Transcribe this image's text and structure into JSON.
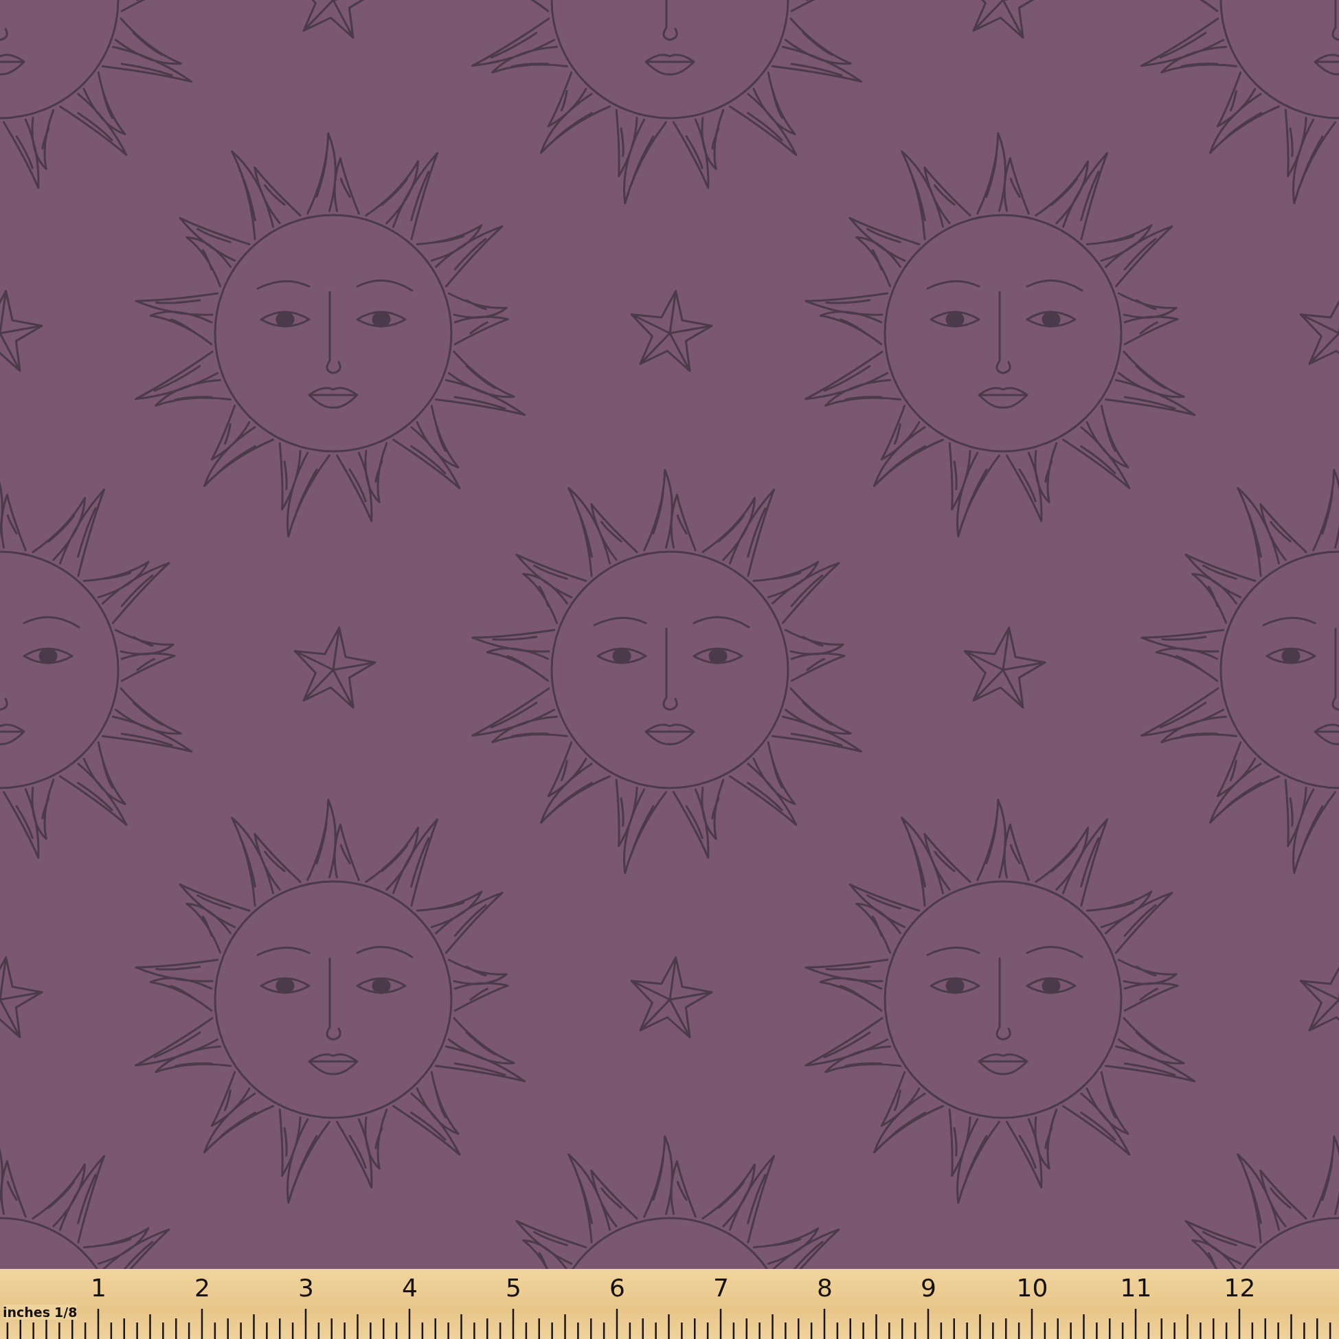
{
  "ruler": {
    "unit_label": "inches",
    "fraction_label": "1/8",
    "numbers": [
      "1",
      "2",
      "3",
      "4",
      "5",
      "6",
      "7",
      "8",
      "9",
      "10",
      "11",
      "12"
    ]
  }
}
